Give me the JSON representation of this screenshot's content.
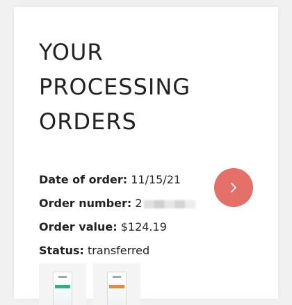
{
  "header": {
    "title_lines": [
      "YOUR",
      "PROCESSING",
      "ORDERS"
    ]
  },
  "order": {
    "date_label": "Date of order:",
    "date_value": "11/15/21",
    "number_label": "Order number:",
    "number_value_visible": "2",
    "value_label": "Order value:",
    "value_value": "$124.19",
    "status_label": "Status:",
    "status_value": "transferred"
  },
  "actions": {
    "go_icon": "chevron-right-icon",
    "accent_color": "#e37069"
  },
  "products": [
    {
      "icon": "product-box-icon",
      "band_color": "#3aa98a"
    },
    {
      "icon": "product-box-icon",
      "band_color": "#e08a4a"
    }
  ]
}
